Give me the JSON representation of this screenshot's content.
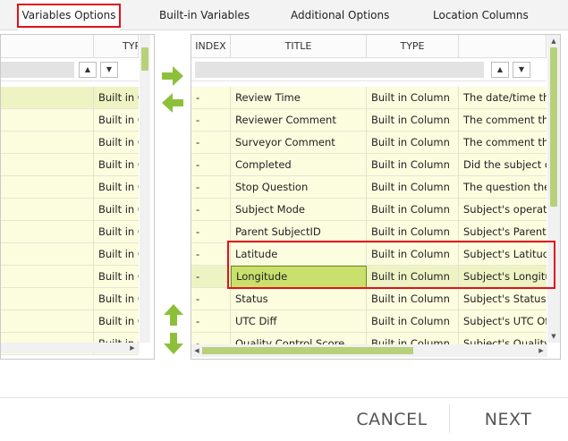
{
  "tabs": [
    {
      "label": "Variables Options",
      "active": true
    },
    {
      "label": "Built-in Variables",
      "active": false
    },
    {
      "label": "Additional Options",
      "active": false
    },
    {
      "label": "Location Columns",
      "active": false
    }
  ],
  "left_grid": {
    "header_type": "TYPE",
    "rows": [
      "Built in Column",
      "Built in Column",
      "Built in Column",
      "Built in Column",
      "Built in Column",
      "Built in Column",
      "Built in Column",
      "Built in Column",
      "Built in Column",
      "Built in Column",
      "Built in Column",
      "Built in Column"
    ],
    "selected_row": 0
  },
  "right_grid": {
    "headers": {
      "index": "INDEX",
      "title": "TITLE",
      "type": "TYPE",
      "description": ""
    },
    "rows": [
      {
        "index": "-",
        "title": "Review Time",
        "type": "Built in Column",
        "description": "The date/time that the review was completed"
      },
      {
        "index": "-",
        "title": "Reviewer Comment",
        "type": "Built in Column",
        "description": "The comment that the reviewer entered"
      },
      {
        "index": "-",
        "title": "Surveyor Comment",
        "type": "Built in Column",
        "description": "The comment that the surveyor entered"
      },
      {
        "index": "-",
        "title": "Completed",
        "type": "Built in Column",
        "description": "Did the subject complete the survey"
      },
      {
        "index": "-",
        "title": "Stop Question",
        "type": "Built in Column",
        "description": "The question the subject stopped at"
      },
      {
        "index": "-",
        "title": "Subject Mode",
        "type": "Built in Column",
        "description": "Subject's operation mode"
      },
      {
        "index": "-",
        "title": "Parent SubjectID",
        "type": "Built in Column",
        "description": "Subject's Parent SubjectID"
      },
      {
        "index": "-",
        "title": "Latitude",
        "type": "Built in Column",
        "description": "Subject's Latitude"
      },
      {
        "index": "-",
        "title": "Longitude",
        "type": "Built in Column",
        "description": "Subject's Longitude"
      },
      {
        "index": "-",
        "title": "Status",
        "type": "Built in Column",
        "description": "Subject's Status"
      },
      {
        "index": "-",
        "title": "UTC Diff",
        "type": "Built in Column",
        "description": "Subject's UTC Offset"
      },
      {
        "index": "-",
        "title": "Quality Control Score",
        "type": "Built in Column",
        "description": "Subject's Quality Control Score"
      }
    ],
    "selected_row": 8
  },
  "sort_glyphs": {
    "up": "▲",
    "down": "▼",
    "left": "◀",
    "right": "▶"
  },
  "buttons": {
    "cancel": "CANCEL",
    "next": "NEXT"
  },
  "colors": {
    "accent_green": "#8dc03a",
    "highlight_red": "#e0121a",
    "row_bg": "#fcfcdf",
    "selected_row_bg": "#eef3c4"
  }
}
